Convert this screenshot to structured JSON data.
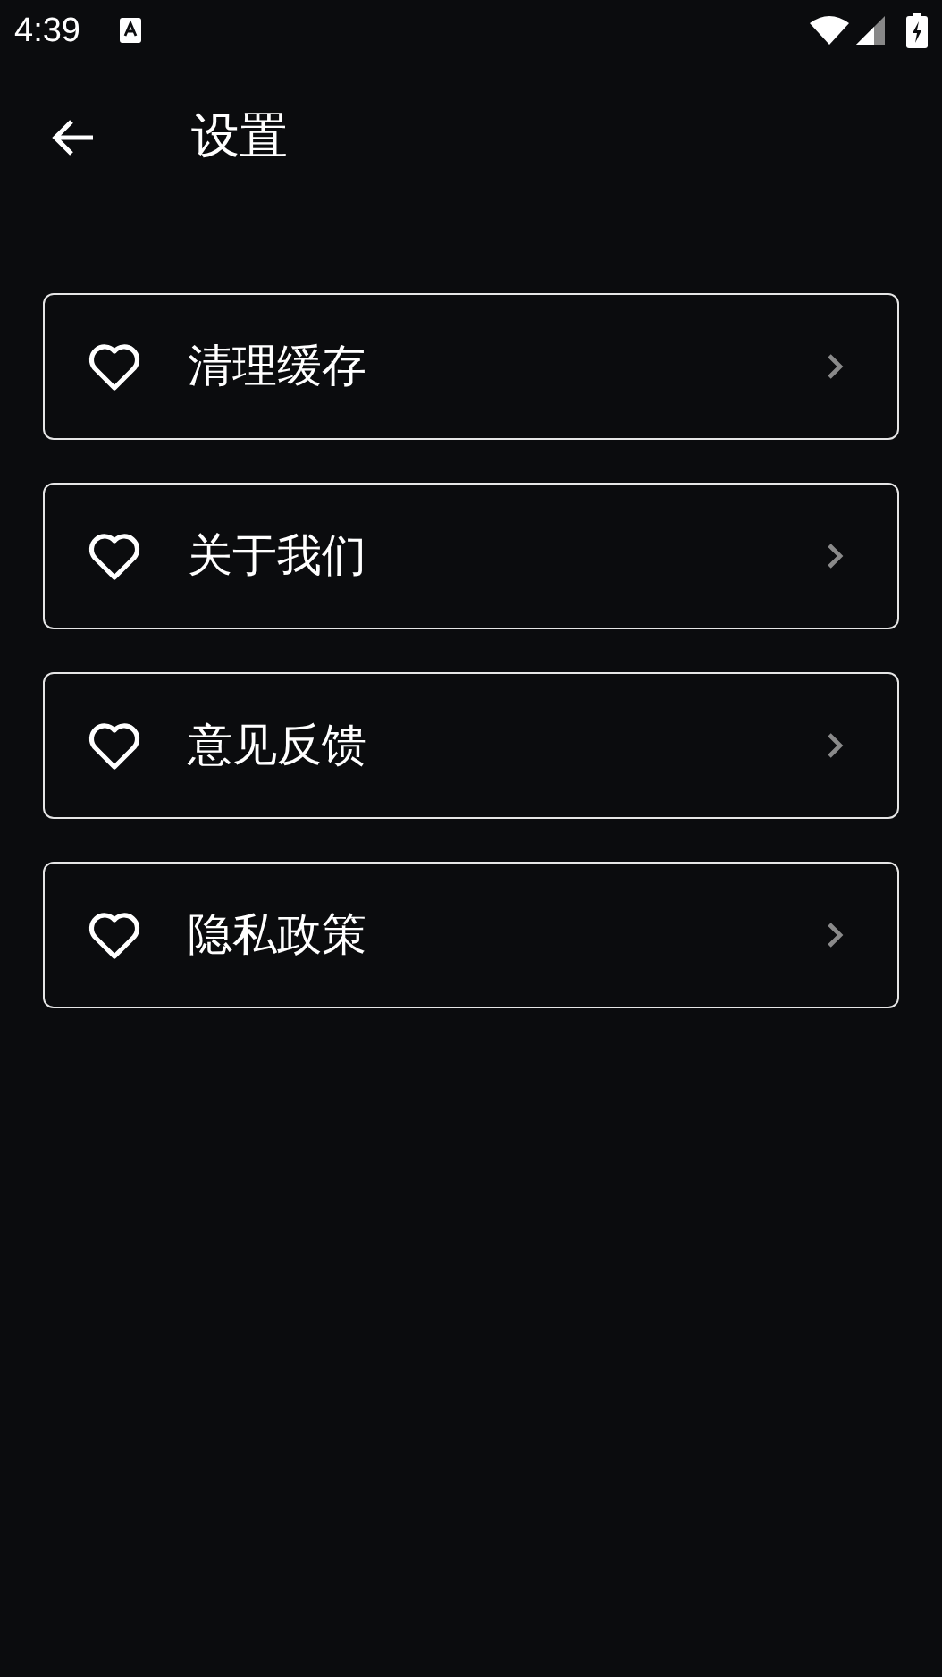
{
  "status_bar": {
    "time": "4:39"
  },
  "app_bar": {
    "title": "设置"
  },
  "items": [
    {
      "label": "清理缓存"
    },
    {
      "label": "关于我们"
    },
    {
      "label": "意见反馈"
    },
    {
      "label": "隐私政策"
    }
  ]
}
